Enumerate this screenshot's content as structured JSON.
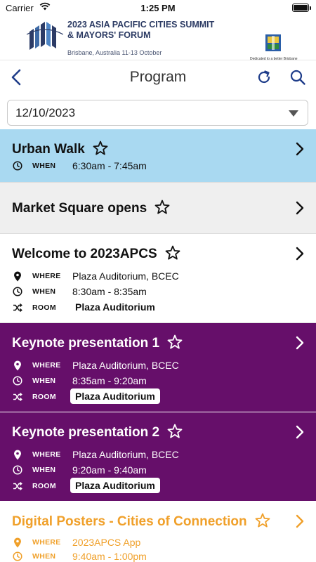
{
  "status_bar": {
    "carrier": "Carrier",
    "time": "1:25 PM"
  },
  "banner": {
    "title_line1": "2023 ASIA PACIFIC CITIES SUMMIT",
    "title_line2": "& MAYORS' FORUM",
    "subtitle": "Brisbane, Australia   11-13 October",
    "council_tagline": "Dedicated to a better Brisbane"
  },
  "nav": {
    "title": "Program"
  },
  "date_select": {
    "value": "12/10/2023"
  },
  "labels": {
    "where": "WHERE",
    "when": "WHEN",
    "room": "ROOM"
  },
  "sessions": [
    {
      "title": "Urban Walk",
      "when": "6:30am - 7:45am"
    },
    {
      "title": "Market Square opens"
    },
    {
      "title": "Welcome to 2023APCS",
      "where": "Plaza Auditorium, BCEC",
      "when": "8:30am - 8:35am",
      "room": "Plaza Auditorium"
    },
    {
      "title": "Keynote presentation 1",
      "where": "Plaza Auditorium, BCEC",
      "when": "8:35am - 9:20am",
      "room": "Plaza Auditorium"
    },
    {
      "title": "Keynote presentation 2",
      "where": "Plaza Auditorium, BCEC",
      "when": "9:20am - 9:40am",
      "room": "Plaza Auditorium"
    },
    {
      "title": "Digital Posters - Cities of Connection",
      "where": "2023APCS App",
      "when": "9:40am - 1:00pm"
    }
  ],
  "colors": {
    "accent": "#1f3d8a",
    "blue_card": "#a9d9f1",
    "grey_card": "#efefef",
    "purple_card": "#660f6a",
    "orange_text": "#f0a02a"
  },
  "icons": [
    "wifi-icon",
    "battery-icon",
    "back-icon",
    "refresh-icon",
    "search-icon",
    "star-icon",
    "chevron-right-icon",
    "pin-icon",
    "clock-icon",
    "shuffle-icon",
    "caret-down-icon"
  ]
}
